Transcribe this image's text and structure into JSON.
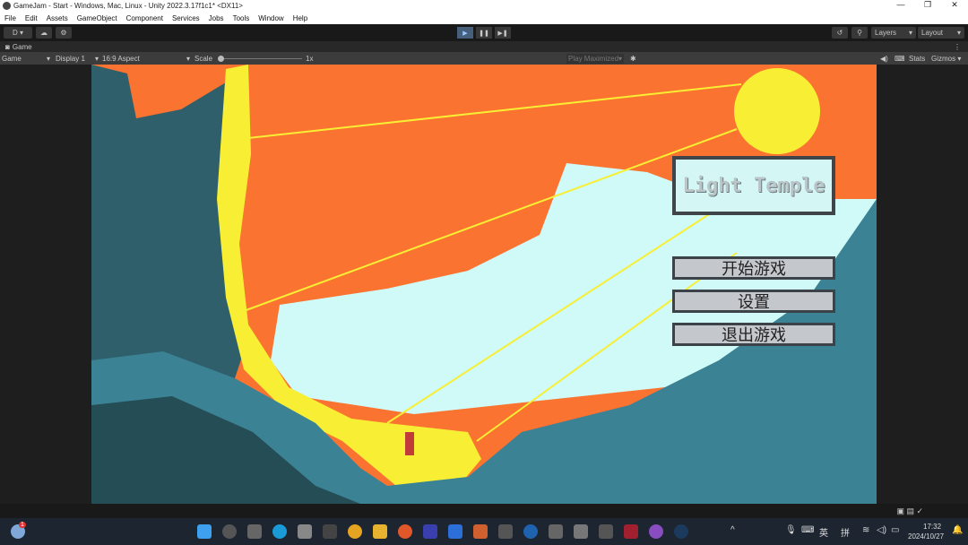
{
  "window": {
    "title": "GameJam - Start - Windows, Mac, Linux - Unity 2022.3.17f1c1* <DX11>",
    "controls": [
      "—",
      "❐",
      "✕"
    ]
  },
  "menu": [
    "File",
    "Edit",
    "Assets",
    "GameObject",
    "Component",
    "Services",
    "Jobs",
    "Tools",
    "Window",
    "Help"
  ],
  "toolbar": {
    "account": "D ▾",
    "play": "▶",
    "pause": "❚❚",
    "step": "▶❚",
    "layers": "Layers",
    "layout": "Layout"
  },
  "tab": {
    "label": "Game"
  },
  "gamebar": {
    "mode": "Game",
    "display": "Display 1",
    "aspect": "16:9 Aspect",
    "scale_label": "Scale",
    "scale_value": "1x",
    "play_maximized": "Play Maximized",
    "stats": "Stats",
    "gizmos": "Gizmos",
    "scale_fraction": 0.0
  },
  "game": {
    "title": "Light Temple",
    "buttons": [
      "开始游戏",
      "设置",
      "退出游戏"
    ]
  },
  "taskbar": {
    "time": "17:32",
    "date": "2024/10/27",
    "ime1": "英",
    "ime2": "拼",
    "weather_badge": "1"
  },
  "colors": {
    "sky": "#fb7330",
    "sun": "#f8ef35",
    "ice": "#cffaf7",
    "rock_dark": "#2e5f6a",
    "rock_mid": "#3b8294"
  }
}
